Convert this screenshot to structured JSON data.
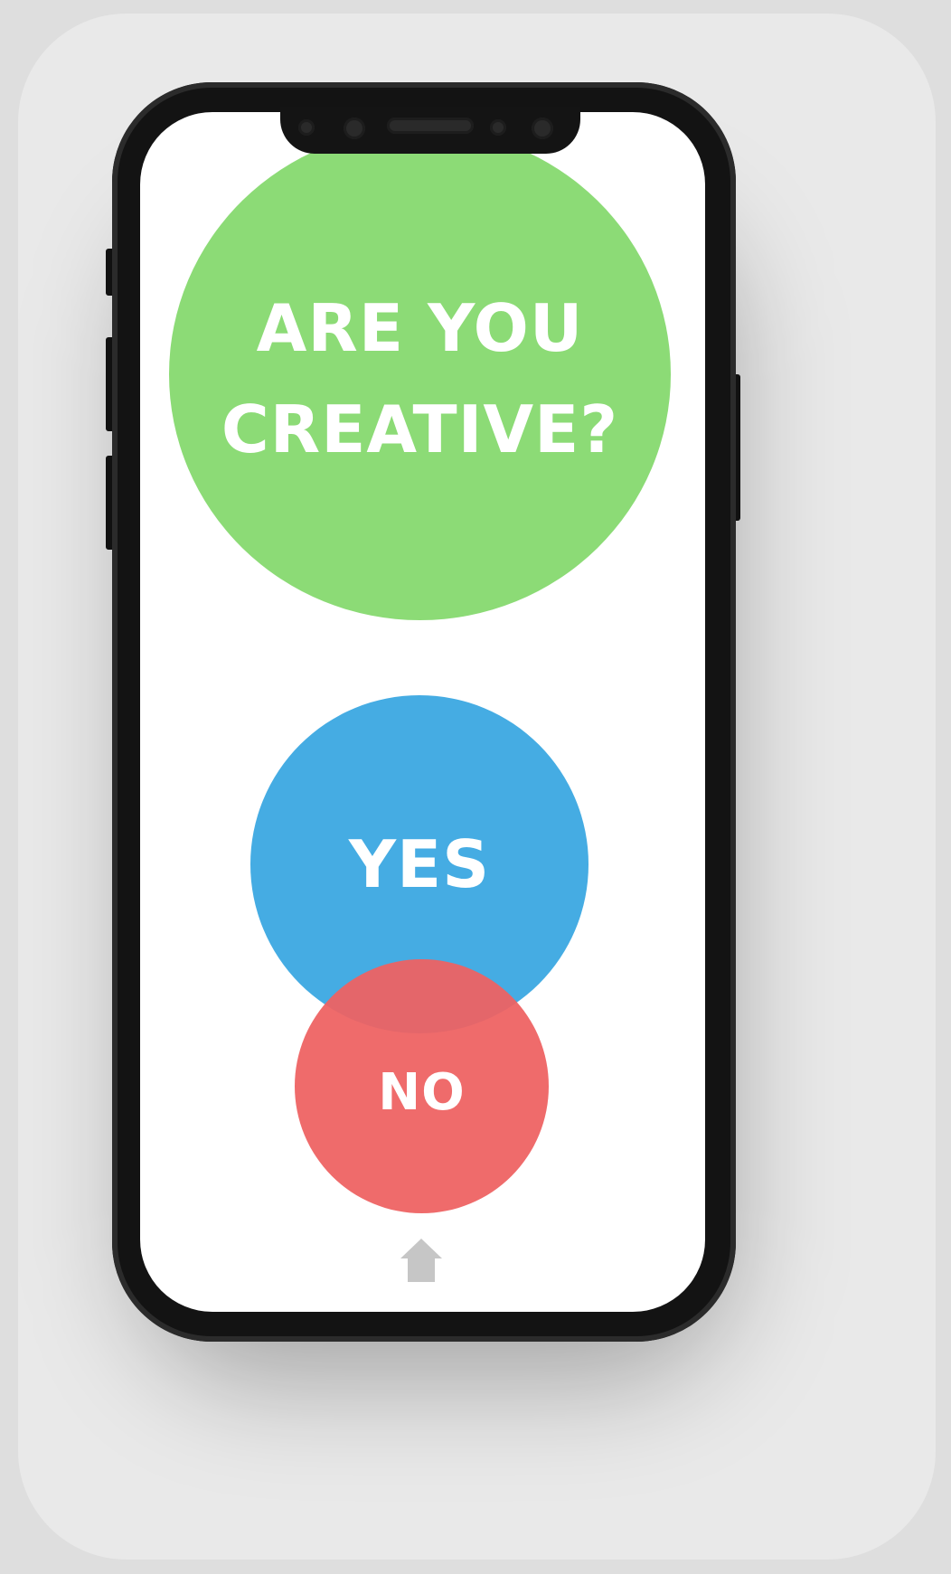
{
  "question": {
    "line1": "ARE YOU",
    "line2": "CREATIVE?",
    "color": "#8cdb76"
  },
  "answers": {
    "yes_label": "YES",
    "yes_color": "#45ace3",
    "no_label": "NO",
    "no_color": "#ee6262"
  },
  "navigation": {
    "home_icon": "home-icon",
    "icon_color": "#c6c6c6"
  },
  "device": {
    "frame_color": "#131313",
    "screen_color": "#ffffff"
  }
}
